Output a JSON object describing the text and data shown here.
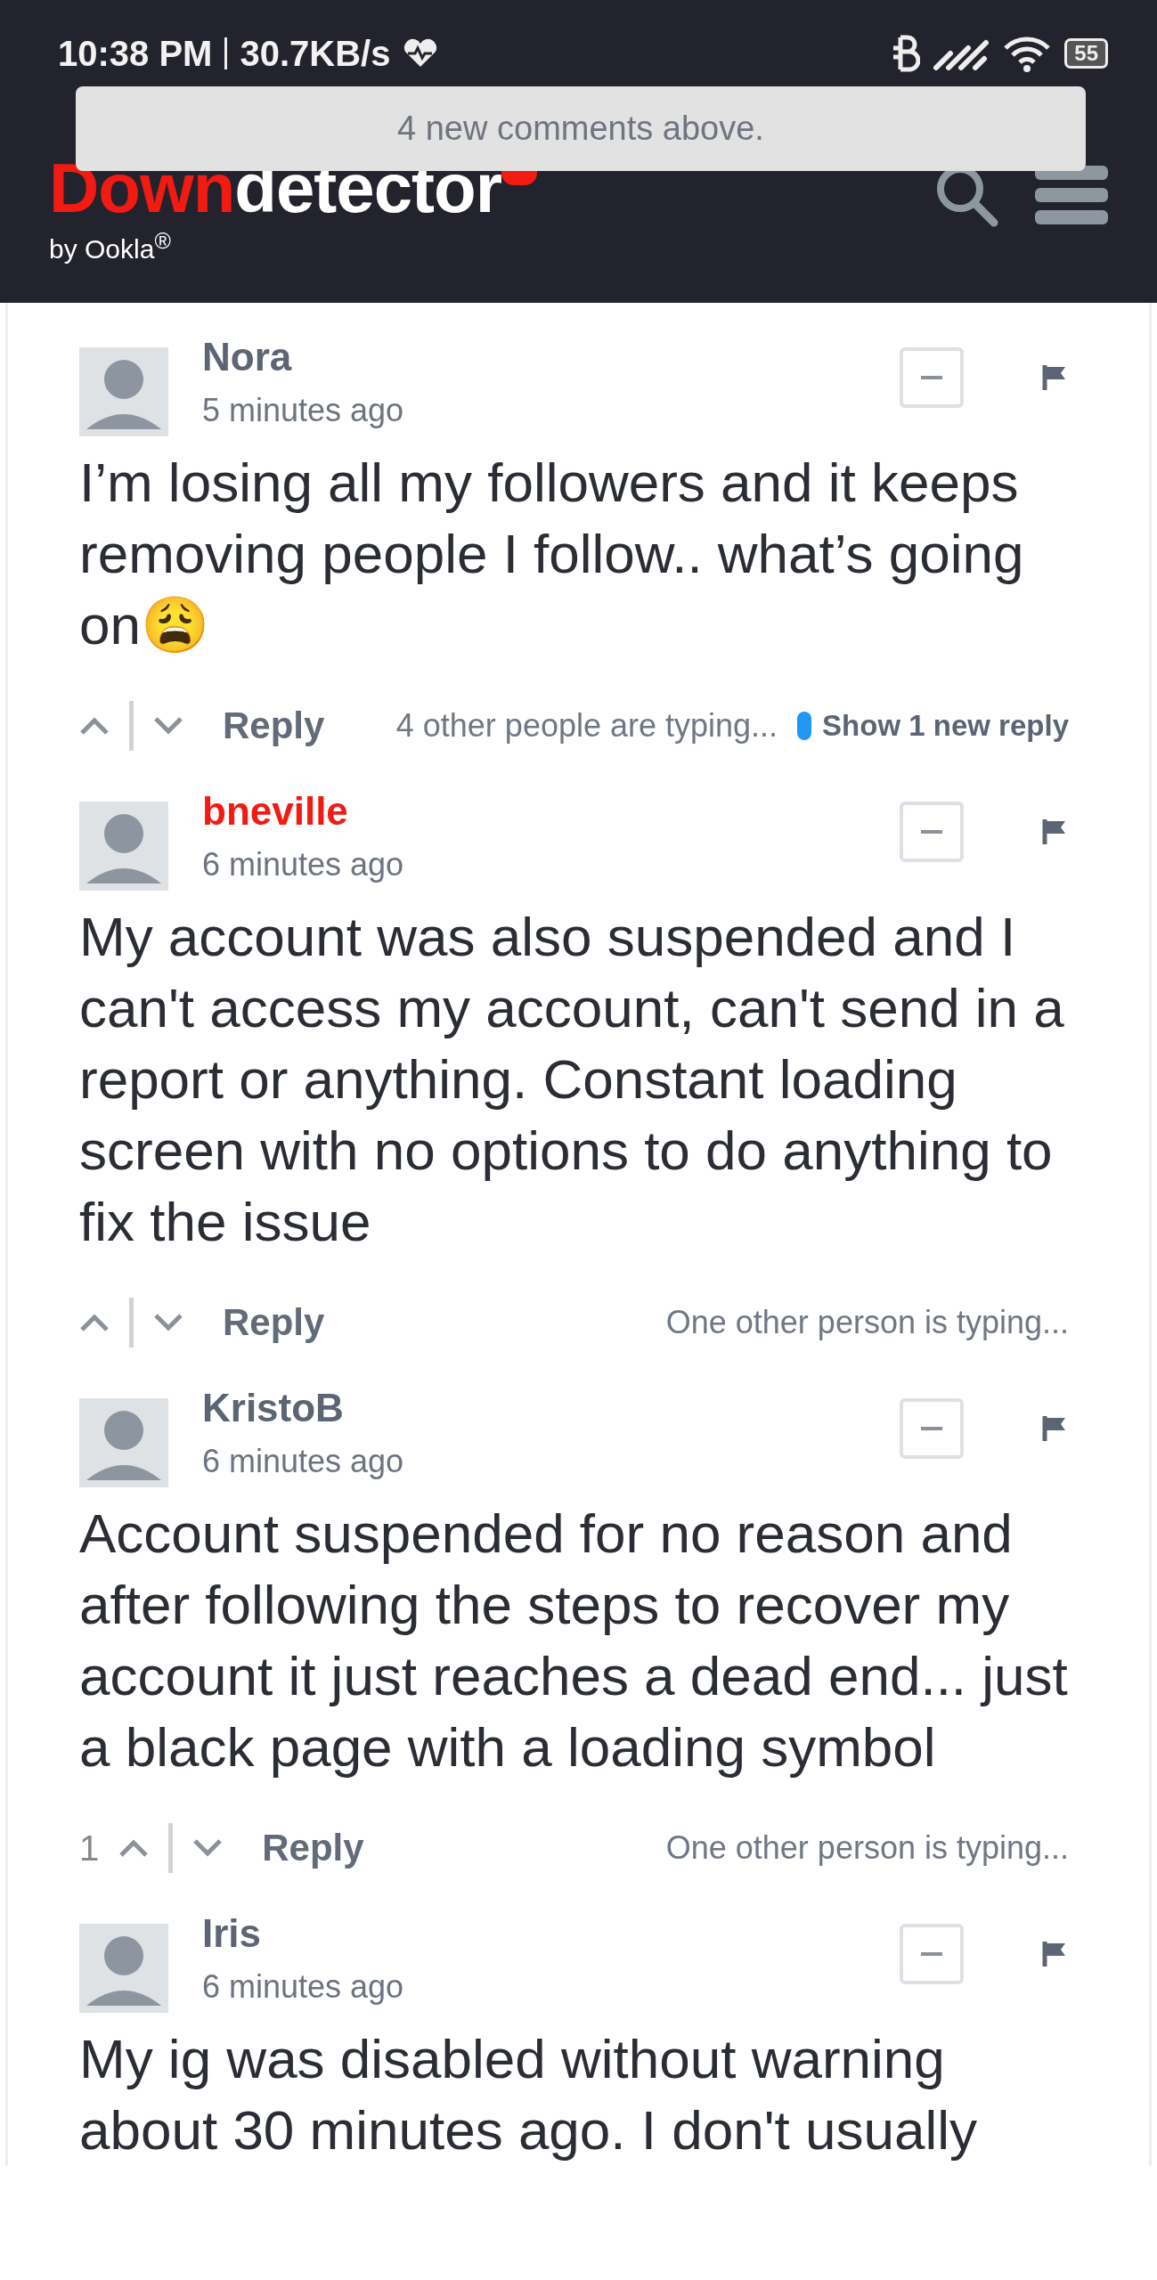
{
  "status_bar": {
    "time": "10:38 PM",
    "speed": "30.7KB/s",
    "battery": "55"
  },
  "toast": "4 new comments above.",
  "header": {
    "logo_red": "Down",
    "logo_white": "detector",
    "tagline": "by Ookla$^{®}$"
  },
  "comments": [
    {
      "author": "Nora",
      "highlighted": false,
      "time": "5 minutes ago",
      "body": "I’m losing all my followers and it keeps removing people I follow.. what’s going on😩",
      "action": "Reply",
      "typing": "4 other people are typing...",
      "new_replies": "Show 1 new reply"
    },
    {
      "author": "bneville",
      "highlighted": true,
      "time": "6 minutes ago",
      "body": "My account was also suspended and I can't access my account, can't send in a report or anything. Constant loading screen with no options to do anything to fix the issue",
      "action": "Reply",
      "typing": "One other person is typing..."
    },
    {
      "author": "KristoB",
      "highlighted": false,
      "time": "6 minutes ago",
      "body": "Account suspended for no reason and after following the steps to recover my account it just reaches a dead end... just a black page with a loading symbol",
      "votes": "1",
      "action": "Reply",
      "typing": "One other person is typing..."
    },
    {
      "author": "Iris",
      "highlighted": false,
      "time": "6 minutes ago",
      "body": "My ig was disabled without warning about 30 minutes ago. I don't usually"
    }
  ]
}
